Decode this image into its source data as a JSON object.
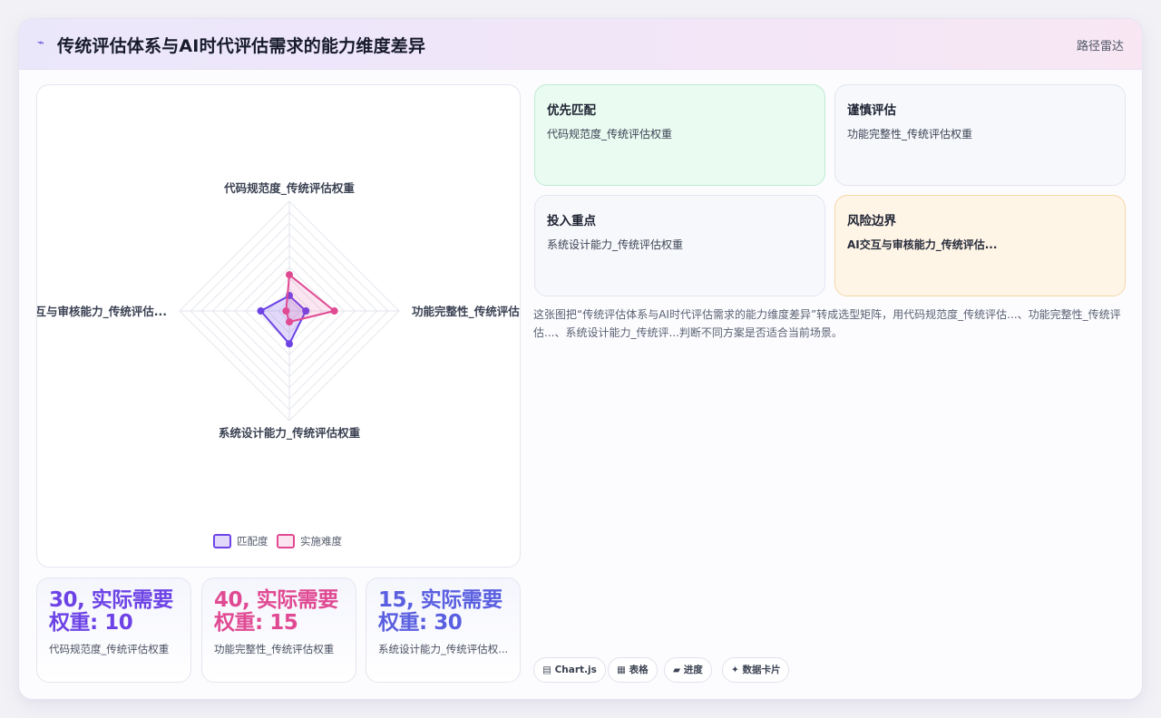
{
  "header": {
    "title": "传统评估体系与AI时代评估需求的能力维度差异",
    "tag": "路径雷达"
  },
  "colors": {
    "match": "#6d43e6",
    "difficulty": "#e04a93",
    "kpi3": "#5a5fe0"
  },
  "chart_data": {
    "type": "radar",
    "axes": [
      "代码规范度_传统评估权重",
      "功能完整性_传统评估权重",
      "系统设计能力_传统评估权重",
      "AI交互与审核能力_传统评估权重"
    ],
    "axis_labels_display": [
      "代码规范度_传统评估权重",
      "功能完整性_传统评估权重",
      "系统设计能力_传统评估权重",
      "AI交互与审核能力_传统评估..."
    ],
    "rmax": 100,
    "rings": 10,
    "grid": true,
    "legend_position": "bottom",
    "series": [
      {
        "name": "匹配度",
        "values": [
          14,
          15,
          30,
          26
        ]
      },
      {
        "name": "实施难度",
        "values": [
          33,
          41,
          10,
          3
        ]
      }
    ]
  },
  "kpis": [
    {
      "value": "30, 实际需要权重: 10",
      "label": "代码规范度_传统评估权重"
    },
    {
      "value": "40, 实际需要权重: 15",
      "label": "功能完整性_传统评估权重"
    },
    {
      "value": "15, 实际需要权重: 30",
      "label": "系统设计能力_传统评估权..."
    }
  ],
  "recommendations": [
    {
      "title": "优先匹配",
      "detail": "代码规范度_传统评估权重"
    },
    {
      "title": "谨慎评估",
      "detail": "功能完整性_传统评估权重"
    },
    {
      "title": "投入重点",
      "detail": "系统设计能力_传统评估权重"
    },
    {
      "title": "风险边界",
      "detail": "AI交互与审核能力_传统评估..."
    }
  ],
  "description": "这张图把“传统评估体系与AI时代评估需求的能力维度差异”转成选型矩阵，用代码规范度_传统评估...、功能完整性_传统评估...、系统设计能力_传统评...判断不同方案是否适合当前场景。",
  "chips": [
    {
      "icon": "▤",
      "label": "Chart.js"
    },
    {
      "icon": "▦",
      "label": "表格"
    },
    {
      "icon": "▰",
      "label": "进度"
    },
    {
      "icon": "✦",
      "label": "数据卡片"
    }
  ]
}
